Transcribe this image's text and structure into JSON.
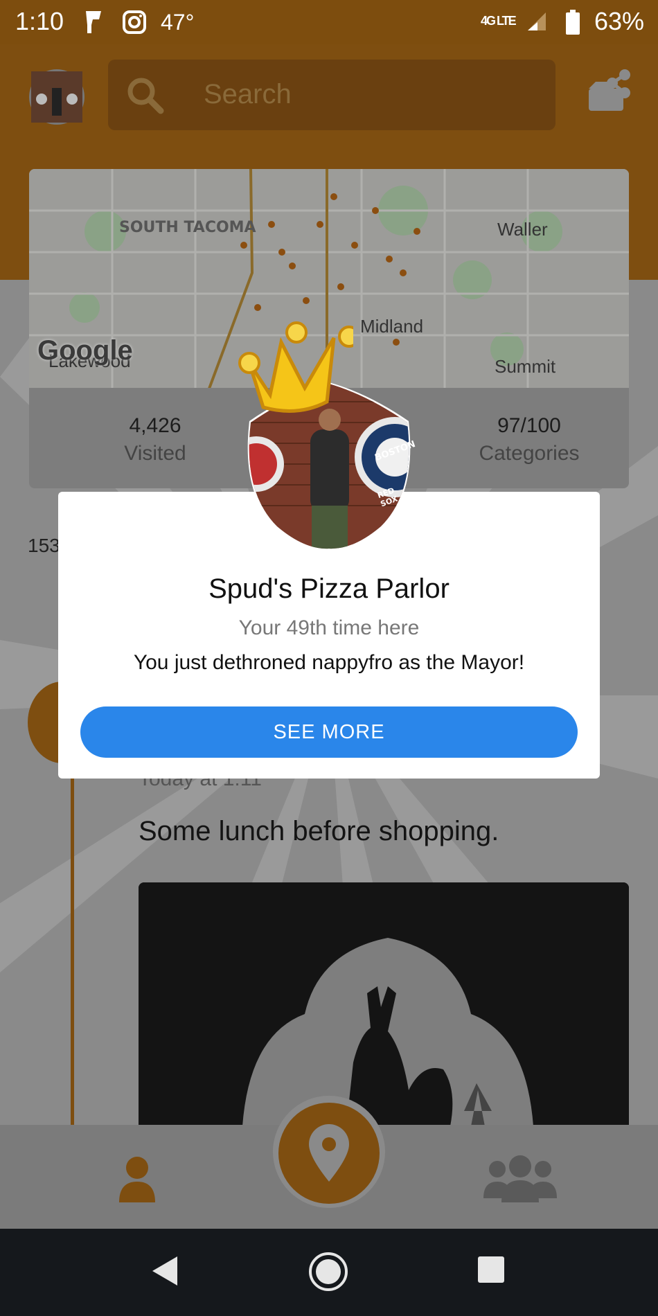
{
  "status_bar": {
    "time": "1:10",
    "temperature": "47°",
    "network": "4G LTE",
    "battery": "63%"
  },
  "header": {
    "search_placeholder": "Search"
  },
  "map": {
    "labels": [
      "SOUTH TACOMA",
      "Waller",
      "Midland",
      "Lakewood",
      "Summit"
    ],
    "attribution": "Google"
  },
  "stats": [
    {
      "value": "4,426",
      "label": "Visited"
    },
    {
      "value": "97/100",
      "label": "Categories"
    }
  ],
  "feed": {
    "partial_count": "153",
    "timestamp": "Today at 1:11",
    "post_text": "Some lunch before shopping."
  },
  "dialog": {
    "venue_name": "Spud's Pizza Parlor",
    "visit_text": "Your 49th time here",
    "mayor_text": "You just dethroned nappyfro as the Mayor!",
    "button_label": "SEE MORE",
    "photo_lettering": [
      "BOSTON",
      "RED SOX"
    ]
  },
  "colors": {
    "accent": "#F5A623",
    "button": "#2A86EA",
    "dim_overlay": "#7B7B7B"
  }
}
